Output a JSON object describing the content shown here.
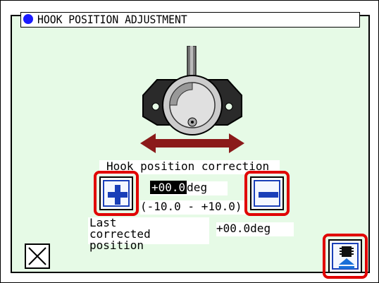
{
  "window": {
    "title": "HOOK POSITION ADJUSTMENT"
  },
  "illustration": {
    "icon": "hook-mechanism-with-double-arrow"
  },
  "correction": {
    "label": "Hook position correction",
    "value": "+00.0",
    "unit": "deg",
    "range": "(-10.0 - +10.0)"
  },
  "last": {
    "label": "Last corrected position",
    "value": "+00.0",
    "unit": "deg"
  },
  "buttons": {
    "plus_icon": "plus-icon",
    "minus_icon": "minus-icon",
    "close_icon": "close-icon",
    "save_icon": "save-to-memory-icon"
  },
  "colors": {
    "background": "#e6fae6",
    "highlight_ring": "#e00000",
    "button_accent": "#1a3fb8",
    "arrow": "#8b1a1a"
  }
}
